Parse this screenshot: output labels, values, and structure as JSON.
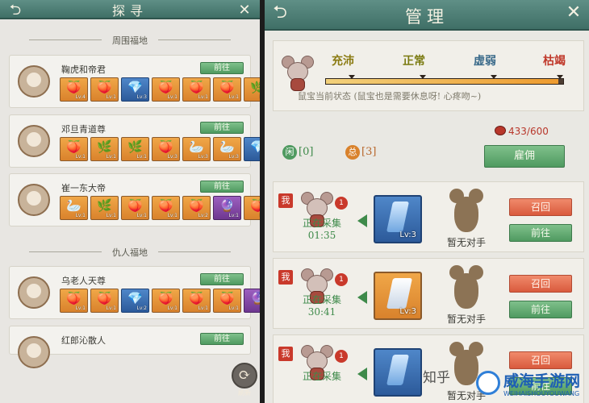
{
  "left": {
    "title": "探寻",
    "section1": "周围福地",
    "section2": "仇人福地",
    "goto_label": "前往",
    "swap_label": "刷新",
    "cards": [
      {
        "name": "鞠虎和帝君",
        "items": [
          {
            "kind": "orange",
            "glyph": "🍑",
            "lv": "Lv:4"
          },
          {
            "kind": "orange",
            "glyph": "🍑",
            "lv": "Lv:1"
          },
          {
            "kind": "blue",
            "glyph": "💎",
            "lv": "Lv:3"
          },
          {
            "kind": "orange",
            "glyph": "🍑",
            "lv": "Lv:1"
          },
          {
            "kind": "orange",
            "glyph": "🍑",
            "lv": "Lv:1"
          },
          {
            "kind": "orange",
            "glyph": "🍑",
            "lv": "Lv:1"
          },
          {
            "kind": "orange",
            "glyph": "🌿",
            "lv": "Lv:1"
          }
        ]
      },
      {
        "name": "邓旦青道尊",
        "items": [
          {
            "kind": "orange",
            "glyph": "🍑",
            "lv": "Lv:1"
          },
          {
            "kind": "orange",
            "glyph": "🌿",
            "lv": "Lv:1"
          },
          {
            "kind": "orange",
            "glyph": "🌿",
            "lv": "Lv:1"
          },
          {
            "kind": "orange",
            "glyph": "🍑",
            "lv": "Lv:3"
          },
          {
            "kind": "orange",
            "glyph": "🦢",
            "lv": "Lv:3"
          },
          {
            "kind": "orange",
            "glyph": "🦢",
            "lv": "Lv:3"
          },
          {
            "kind": "blue",
            "glyph": "💎",
            "lv": "Lv:3"
          }
        ]
      },
      {
        "name": "崔一东大帝",
        "items": [
          {
            "kind": "orange",
            "glyph": "🦢",
            "lv": "Lv:1"
          },
          {
            "kind": "orange",
            "glyph": "🌿",
            "lv": "Lv:1"
          },
          {
            "kind": "orange",
            "glyph": "🍑",
            "lv": "Lv:1"
          },
          {
            "kind": "orange",
            "glyph": "🍑",
            "lv": "Lv:1"
          },
          {
            "kind": "orange",
            "glyph": "🍑",
            "lv": "Lv:2"
          },
          {
            "kind": "purple",
            "glyph": "🔮",
            "lv": "Lv:1"
          },
          {
            "kind": "orange",
            "glyph": "🍑",
            "lv": "Lv:1"
          }
        ]
      },
      {
        "name": "乌老人天尊",
        "items": [
          {
            "kind": "orange",
            "glyph": "🍑",
            "lv": "Lv:1"
          },
          {
            "kind": "orange",
            "glyph": "🍑",
            "lv": "Lv:1"
          },
          {
            "kind": "blue",
            "glyph": "💎",
            "lv": "Lv:2"
          },
          {
            "kind": "orange",
            "glyph": "🍑",
            "lv": "Lv:1"
          },
          {
            "kind": "orange",
            "glyph": "🍑",
            "lv": "Lv:1"
          },
          {
            "kind": "orange",
            "glyph": "🍑",
            "lv": "Lv:1"
          },
          {
            "kind": "purple",
            "glyph": "🔮",
            "lv": "Lv:1"
          }
        ]
      },
      {
        "name": "红郎沁散人",
        "items": []
      }
    ]
  },
  "right": {
    "title": "管理",
    "moods": [
      "充沛",
      "正常",
      "虚弱",
      "枯竭"
    ],
    "mood_colors": [
      "#8a7a10",
      "#7a7a10",
      "#3a6a8a",
      "#c0392b"
    ],
    "mood_level": 0.98,
    "status_text": "鼠宝当前状态 (鼠宝也是需要休息呀! 心疼吻~)",
    "idle_badge": "闲",
    "idle_count": "[0]",
    "busy_badge": "总",
    "busy_count": "[3]",
    "resource": "433/600",
    "hire_label": "雇佣",
    "me_badge": "我",
    "collecting_label": "正在采集",
    "no_opponent": "暂无对手",
    "recall_label": "召回",
    "goto_label": "前往",
    "tasks": [
      {
        "num": "1",
        "time": "01:35",
        "mat": "blue",
        "lv": "Lv:3"
      },
      {
        "num": "1",
        "time": "30:41",
        "mat": "orange",
        "lv": "Lv:3"
      },
      {
        "num": "1",
        "time": "",
        "mat": "blue",
        "lv": ""
      }
    ]
  },
  "watermark": {
    "zhihu": "知乎",
    "site": "威海手游网",
    "site_sub": "WEIHAISHOUYOUWANG"
  }
}
